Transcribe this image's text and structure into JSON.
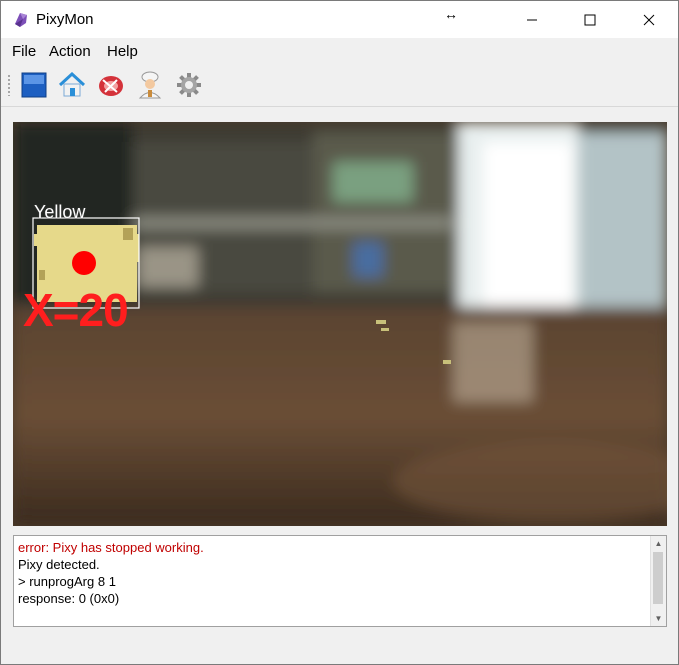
{
  "window": {
    "title": "PixyMon",
    "app_icon": "pixymon-icon",
    "controls": [
      "minimize-icon",
      "maximize-icon",
      "close-icon"
    ],
    "cursor_glyph": "↔"
  },
  "menubar": {
    "items": [
      "File",
      "Action",
      "Help"
    ]
  },
  "toolbar": {
    "icons": [
      "raw-video-icon",
      "home-icon",
      "cooked-video-icon",
      "chef-icon",
      "gear-icon"
    ]
  },
  "video": {
    "block": {
      "signature_label": "Yellow",
      "overlay_text": "X=20",
      "box_color": "#ffffff",
      "dot_color": "#ff0000",
      "text_color": "#ff1e1e"
    }
  },
  "console": {
    "lines": [
      {
        "text": "error: Pixy has stopped working.",
        "kind": "error"
      },
      {
        "text": "Pixy detected.",
        "kind": "info"
      },
      {
        "text": "> runprogArg 8 1",
        "kind": "info"
      },
      {
        "text": "response: 0 (0x0)",
        "kind": "info"
      }
    ],
    "error_color": "#c00000"
  }
}
